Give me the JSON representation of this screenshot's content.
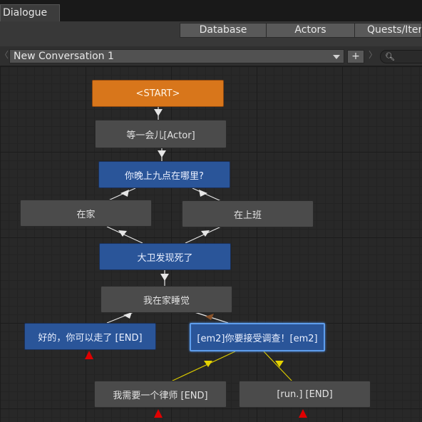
{
  "window": {
    "tab_title": "Dialogue"
  },
  "toolbar": {
    "database": "Database",
    "actors": "Actors",
    "quests": "Quests/Iten"
  },
  "conversation": {
    "selected": "New Conversation 1",
    "add_label": "+",
    "nav_left": "〈",
    "nav_right": "〉",
    "search_icon": "search-icon"
  },
  "nodes": {
    "start": "<START>",
    "wait": "等一会儿[Actor]",
    "question": "你晚上九点在哪里?",
    "home": "在家",
    "work": "在上班",
    "david": "大卫发现死了",
    "sleep": "我在家睡觉",
    "ok_end": "好的，你可以走了 [END]",
    "investigate": "[em2]你要接受调查！[em2]",
    "lawyer_end": "我需要一个律师 [END]",
    "run_end": "[run.] [END]"
  },
  "colors": {
    "start": "#d8761b",
    "npc": "#2a5599",
    "player": "#4b4b4b",
    "yellow_link": "#e6d400",
    "end_marker": "#e00000",
    "selection": "#5e9dec"
  }
}
